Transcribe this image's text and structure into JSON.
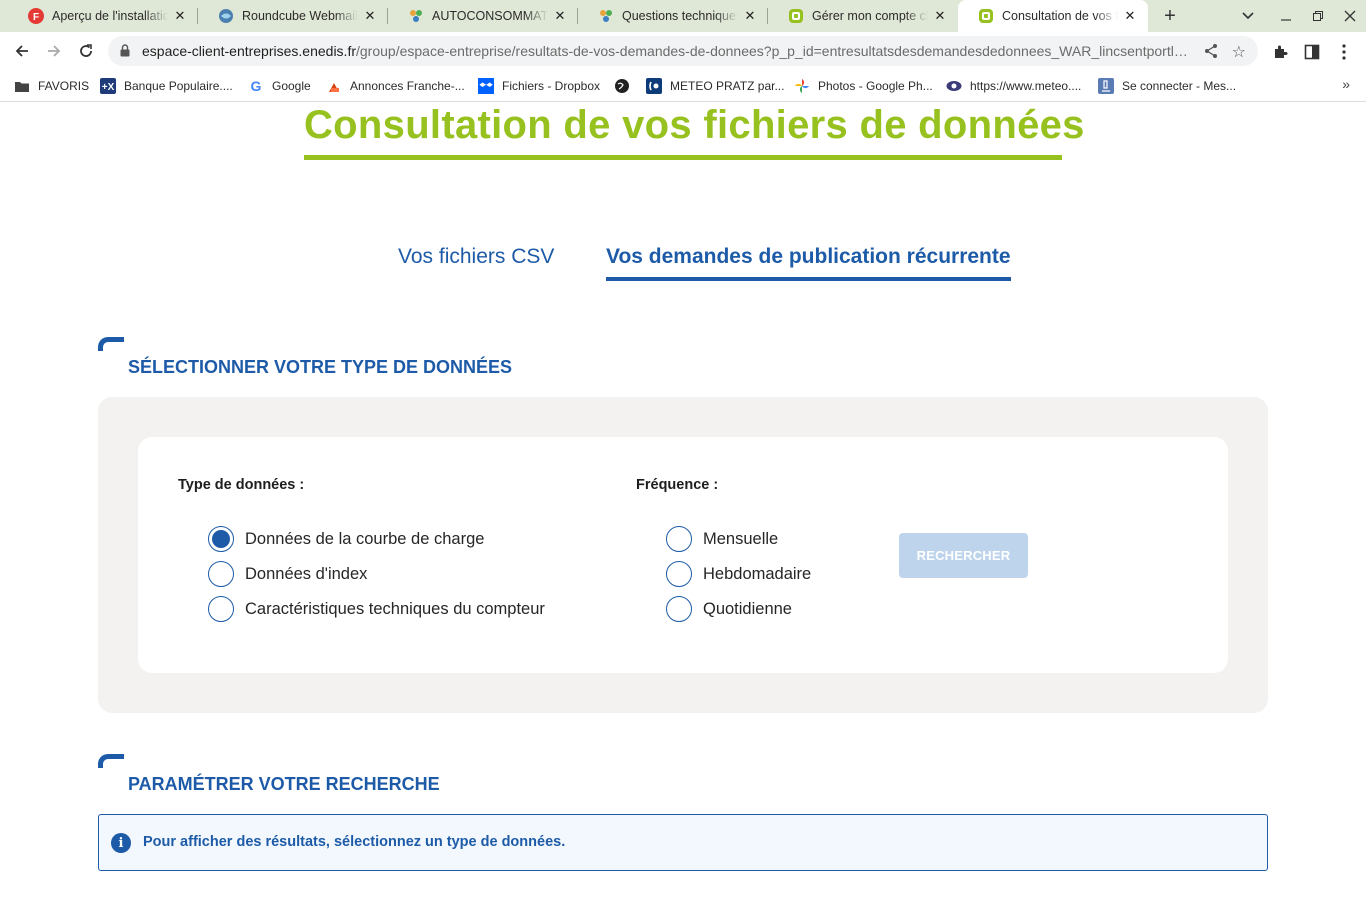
{
  "browser": {
    "tabs": [
      {
        "title": "Aperçu de l'installation",
        "favicon": "red-logo-icon",
        "active": false
      },
      {
        "title": "Roundcube Webmail :: I",
        "favicon": "globe-icon",
        "active": false
      },
      {
        "title": "AUTOCONSOMMATION",
        "favicon": "people-icon",
        "active": false
      },
      {
        "title": "Questions techniques |",
        "favicon": "people-icon",
        "active": false
      },
      {
        "title": "Gérer mon compte clien",
        "favicon": "enedis-icon",
        "active": false
      },
      {
        "title": "Consultation de vos fic",
        "favicon": "enedis-icon",
        "active": true
      }
    ],
    "url_host": "espace-client-entreprises.enedis.fr",
    "url_path": "/group/espace-entreprise/resultats-de-vos-demandes-de-donnees?p_p_id=entresultatsdesdemandesdedonnees_WAR_lincsentportlet...",
    "bookmarks": [
      {
        "label": "FAVORIS",
        "icon": "folder-icon"
      },
      {
        "label": "Banque Populaire....",
        "icon": "bank-icon"
      },
      {
        "label": "Google",
        "icon": "google-icon"
      },
      {
        "label": "Annonces Franche-...",
        "icon": "annonces-icon"
      },
      {
        "label": "Fichiers - Dropbox",
        "icon": "dropbox-icon"
      },
      {
        "label": "",
        "icon": "globe-dark-icon"
      },
      {
        "label": "METEO PRATZ par...",
        "icon": "meteo-icon"
      },
      {
        "label": "Photos - Google Ph...",
        "icon": "photos-icon"
      },
      {
        "label": "https://www.meteo....",
        "icon": "eye-icon"
      },
      {
        "label": "Se connecter - Mes...",
        "icon": "microscope-icon"
      }
    ]
  },
  "page": {
    "title": "Consultation de vos fichiers de données",
    "tabs": [
      {
        "label": "Vos fichiers CSV",
        "active": false
      },
      {
        "label": "Vos demandes de publication récurrente",
        "active": true
      }
    ],
    "section1": {
      "heading": "SÉLECTIONNER VOTRE TYPE DE DONNÉES",
      "type_label": "Type de données :",
      "type_options": [
        {
          "label": "Données de la courbe de charge",
          "checked": true
        },
        {
          "label": "Données d'index",
          "checked": false
        },
        {
          "label": "Caractéristiques techniques du compteur",
          "checked": false
        }
      ],
      "freq_label": "Fréquence :",
      "freq_options": [
        {
          "label": "Mensuelle",
          "checked": false
        },
        {
          "label": "Hebdomadaire",
          "checked": false
        },
        {
          "label": "Quotidienne",
          "checked": false
        }
      ],
      "search_button": "RECHERCHER"
    },
    "section2": {
      "heading": "PARAMÉTRER VOTRE RECHERCHE",
      "info_message": "Pour afficher des résultats, sélectionnez un type de données."
    }
  },
  "colors": {
    "brand_green": "#96c11f",
    "brand_blue": "#1d5ba8",
    "disabled_button": "#bdd4ec",
    "panel_gray": "#f3f2f0"
  }
}
